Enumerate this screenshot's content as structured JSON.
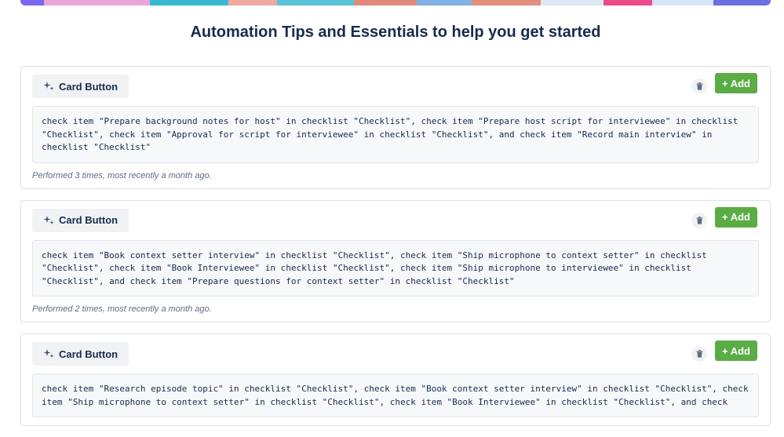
{
  "page_title": "Automation Tips and Essentials to help you get started",
  "banner_colors": [
    "#7b68ee",
    "#e9a5d8",
    "#36b9d1",
    "#f0a8a0",
    "#58c3d8",
    "#e0897a",
    "#7fb2e5",
    "#e38f7d",
    "#dde7f5",
    "#ea4c89",
    "#d8e4f7",
    "#6b6fe0"
  ],
  "colors": {
    "add_button": "#5aac44",
    "chip_bg": "#f1f2f4",
    "code_bg": "#f7f8f9"
  },
  "cards": [
    {
      "type_label": "Card Button",
      "type_icon": "sparkle-icon",
      "delete_icon": "trash-icon",
      "add_label": "+ Add",
      "description": "check item \"Prepare background notes for host\" in checklist \"Checklist\", check item \"Prepare host script for interviewee\" in checklist \"Checklist\", check item \"Approval for script for interviewee\" in checklist \"Checklist\", and check item \"Record main interview\" in checklist \"Checklist\"",
      "meta": "Performed 3 times, most recently a month ago."
    },
    {
      "type_label": "Card Button",
      "type_icon": "sparkle-icon",
      "delete_icon": "trash-icon",
      "add_label": "+ Add",
      "description": "check item \"Book context setter interview\" in checklist \"Checklist\", check item \"Ship microphone to context setter\" in checklist \"Checklist\", check item \"Book Interviewee\" in checklist \"Checklist\", check item \"Ship microphone to interviewee\" in checklist \"Checklist\", and check item \"Prepare questions for context setter\" in checklist \"Checklist\"",
      "meta": "Performed 2 times, most recently a month ago."
    },
    {
      "type_label": "Card Button",
      "type_icon": "sparkle-icon",
      "delete_icon": "trash-icon",
      "add_label": "+ Add",
      "description": "check item \"Research episode topic\" in checklist \"Checklist\", check item \"Book context setter interview\" in checklist \"Checklist\", check item \"Ship microphone to context setter\" in checklist \"Checklist\", check item \"Book Interviewee\" in checklist \"Checklist\", and check",
      "meta": ""
    }
  ]
}
